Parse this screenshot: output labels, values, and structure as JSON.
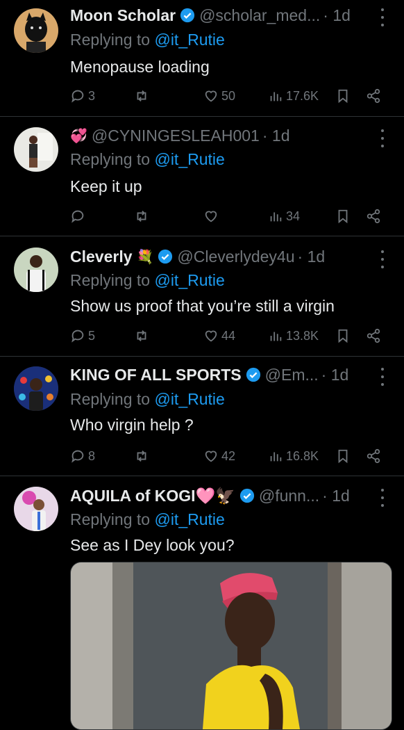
{
  "replies": [
    {
      "name": "Moon Scholar",
      "verified": true,
      "emoji": "",
      "handle": "@scholar_med...",
      "time": "· 1d",
      "replying_prefix": "Replying to ",
      "replying_handle": "@it_Rutie",
      "text": "Menopause loading",
      "replies_count": "3",
      "retweets_count": "",
      "likes_count": "50",
      "views_count": "17.6K"
    },
    {
      "name": "",
      "verified": false,
      "emoji": "💞",
      "handle": "@CYNINGESLEAH001",
      "time": "· 1d",
      "replying_prefix": "Replying to ",
      "replying_handle": "@it_Rutie",
      "text": "Keep it up",
      "replies_count": "",
      "retweets_count": "",
      "likes_count": "",
      "views_count": "34"
    },
    {
      "name": "Cleverly",
      "verified": true,
      "emoji": "💐",
      "handle": "@Cleverlydey4u",
      "time": "· 1d",
      "replying_prefix": "Replying to ",
      "replying_handle": "@it_Rutie",
      "text": "Show us proof that you’re still a virgin",
      "replies_count": "5",
      "retweets_count": "",
      "likes_count": "44",
      "views_count": "13.8K"
    },
    {
      "name": "KING OF ALL SPORTS",
      "verified": true,
      "emoji": "",
      "handle": "@Em...",
      "time": "· 1d",
      "replying_prefix": "Replying to ",
      "replying_handle": "@it_Rutie",
      "text": "Who virgin help ?",
      "replies_count": "8",
      "retweets_count": "",
      "likes_count": "42",
      "views_count": "16.8K"
    },
    {
      "name": "AQUILA of KOGI🩷🦅",
      "verified": true,
      "emoji": "",
      "handle": "@funn...",
      "time": "· 1d",
      "replying_prefix": "Replying to ",
      "replying_handle": "@it_Rutie",
      "text": "See as I Dey look you?"
    }
  ],
  "colors": {
    "background": "#000000",
    "text": "#e7e9ea",
    "muted": "#71767b",
    "link": "#1d9bf0",
    "verified": "#1d9bf0"
  }
}
